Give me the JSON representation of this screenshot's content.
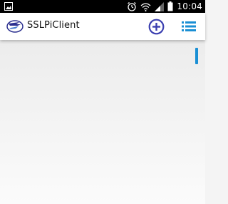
{
  "status_bar": {
    "time": "10:04",
    "icons": [
      "image-notification-icon",
      "alarm-icon",
      "wifi-icon",
      "signal-icon",
      "battery-icon"
    ]
  },
  "app_bar": {
    "title": "SSLPiClient",
    "logo_icon": "sslpi-logo-icon",
    "actions": [
      "add-circle-icon",
      "list-menu-icon"
    ]
  },
  "colors": {
    "accent_purple": "#3b3fb0",
    "accent_blue": "#1a8fd4",
    "app_bar_bg": "#ffffff",
    "content_bg": "#f0f0f0"
  }
}
